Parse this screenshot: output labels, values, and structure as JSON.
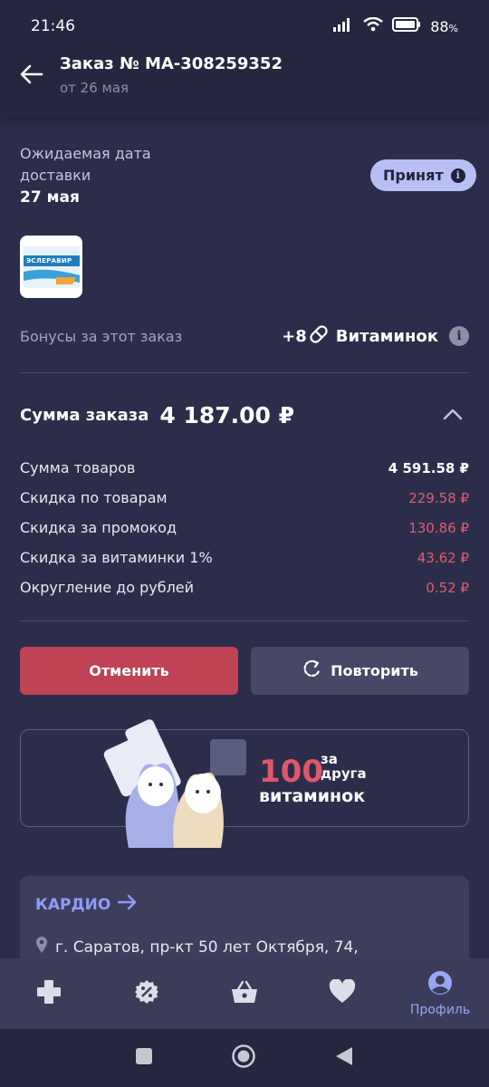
{
  "status_bar": {
    "time": "21:46",
    "battery": "88"
  },
  "header": {
    "title": "Заказ № МА-308259352",
    "subtitle": "от 26 мая"
  },
  "delivery": {
    "label": "Ожидаемая дата доставки",
    "date": "27 мая"
  },
  "status_badge": {
    "label": "Принят",
    "info": "i"
  },
  "product": {
    "thumb_text": "ЭСЛЕРАВИР"
  },
  "bonus": {
    "label": "Бонусы за этот заказ",
    "amount": "+8",
    "unit": "Витаминок",
    "info": "i"
  },
  "order_sum": {
    "label": "Сумма заказа",
    "value": "4 187.00 ₽"
  },
  "breakdown": [
    {
      "label": "Сумма товаров",
      "value": "4 591.58 ₽"
    },
    {
      "label": "Скидка по товарам",
      "value": "229.58 ₽"
    },
    {
      "label": "Скидка за промокод",
      "value": "130.86 ₽"
    },
    {
      "label": "Скидка за витаминки 1%",
      "value": "43.62 ₽"
    },
    {
      "label": "Округление до рублей",
      "value": "0.52 ₽"
    }
  ],
  "buttons": {
    "cancel": "Отменить",
    "repeat": "Повторить"
  },
  "promo": {
    "number": "100",
    "line1": "за",
    "line2": "друга",
    "line3": "витаминок"
  },
  "pharmacy": {
    "name": "КАРДИО",
    "address": "г. Саратов, пр-кт 50 лет Октября, 74,"
  },
  "bottom_nav": {
    "profile_label": "Профиль"
  },
  "colors": {
    "background": "#2c2d4a",
    "accent": "#8e9cf5",
    "danger": "#bf4255",
    "badge": "#b7bff3"
  }
}
